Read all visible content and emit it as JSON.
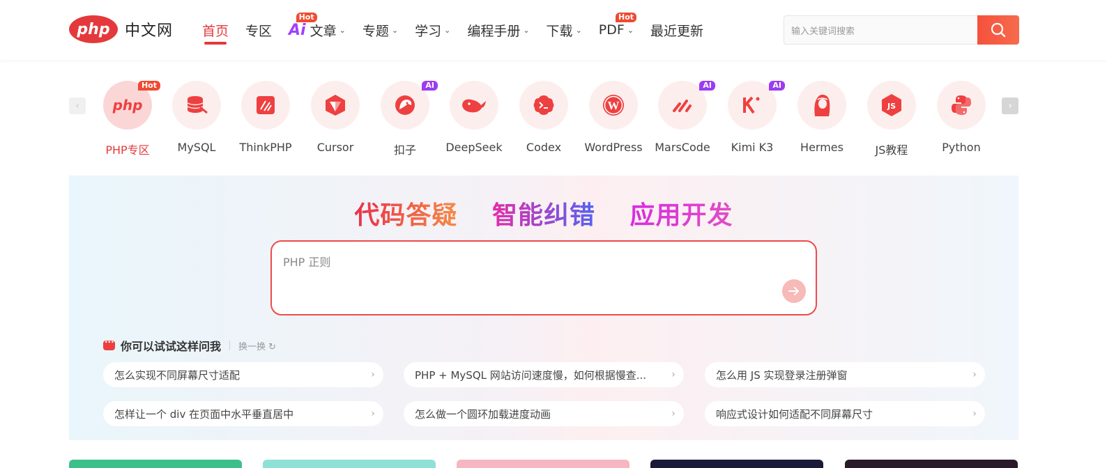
{
  "header": {
    "logo_mark": "php",
    "logo_text": "中文网",
    "nav": [
      {
        "label": "首页",
        "active": true
      },
      {
        "label": "专区"
      },
      {
        "label": "Ai",
        "badge": "Hot"
      },
      {
        "label": "文章",
        "dropdown": true
      },
      {
        "label": "专题",
        "dropdown": true
      },
      {
        "label": "学习",
        "dropdown": true
      },
      {
        "label": "编程手册",
        "dropdown": true
      },
      {
        "label": "下载",
        "dropdown": true
      },
      {
        "label": "PDF",
        "dropdown": true,
        "badge": "Hot"
      },
      {
        "label": "最近更新"
      }
    ],
    "search": {
      "placeholder": "输入关键词搜索"
    }
  },
  "tools": [
    {
      "label": "PHP专区",
      "icon": "php-icon",
      "tag": "Hot",
      "active": true
    },
    {
      "label": "MySQL",
      "icon": "mysql-icon"
    },
    {
      "label": "ThinkPHP",
      "icon": "thinkphp-icon"
    },
    {
      "label": "Cursor",
      "icon": "cursor-icon"
    },
    {
      "label": "扣子",
      "icon": "coze-icon",
      "tag": "AI"
    },
    {
      "label": "DeepSeek",
      "icon": "deepseek-icon"
    },
    {
      "label": "Codex",
      "icon": "codex-icon"
    },
    {
      "label": "WordPress",
      "icon": "wordpress-icon"
    },
    {
      "label": "MarsCode",
      "icon": "marscode-icon",
      "tag": "AI"
    },
    {
      "label": "Kimi K3",
      "icon": "kimi-icon",
      "tag": "AI"
    },
    {
      "label": "Hermes",
      "icon": "hermes-icon"
    },
    {
      "label": "JS教程",
      "icon": "js-icon"
    },
    {
      "label": "Python",
      "icon": "python-icon"
    }
  ],
  "panel": {
    "slogans": [
      "代码答疑",
      "智能纠错",
      "应用开发"
    ],
    "ask_text": "PHP 正则",
    "suggest_title": "你可以试试这样问我",
    "refresh_label": "换一换",
    "suggestions": [
      "怎么实现不同屏幕尺寸适配",
      "PHP + MySQL 网站访问速度慢，如何根据慢查...",
      "怎么用 JS 实现登录注册弹窗",
      "怎样让一个 div 在页面中水平垂直居中",
      "怎么做一个圆环加载进度动画",
      "响应式设计如何适配不同屏幕尺寸"
    ]
  },
  "colors": {
    "brand": "#e4393c",
    "ai_tag": "#9b3cf0",
    "hot_tag": "#ef4b32"
  }
}
